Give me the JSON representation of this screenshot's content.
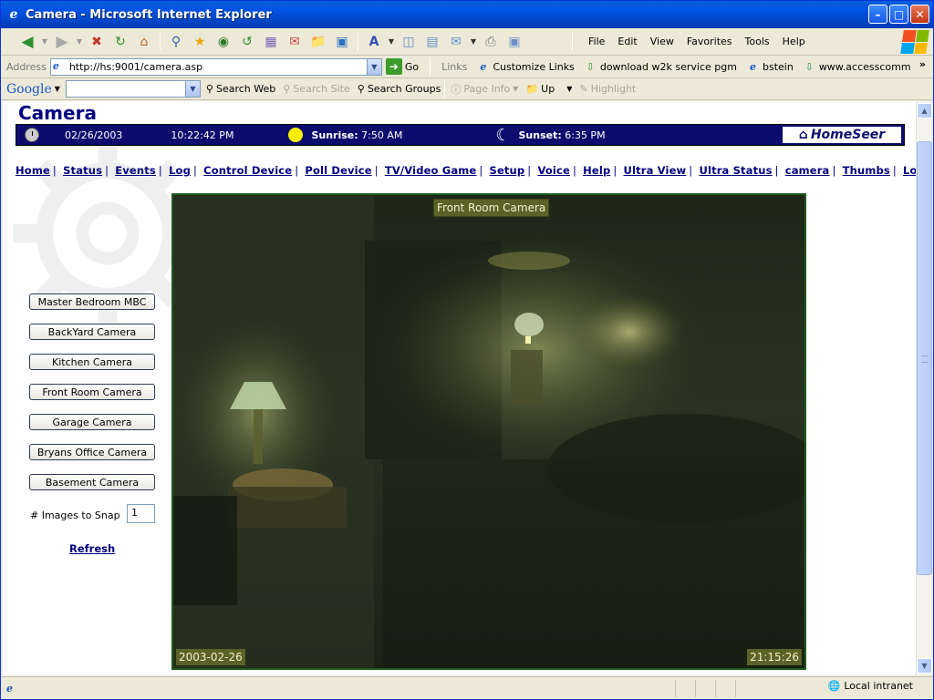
{
  "window": {
    "title": "Camera - Microsoft Internet Explorer"
  },
  "menu": [
    "File",
    "Edit",
    "View",
    "Favorites",
    "Tools",
    "Help"
  ],
  "address": {
    "label": "Address",
    "url": "http://hs:9001/camera.asp",
    "go": "Go"
  },
  "links": {
    "label": "Links",
    "items": [
      "Customize Links",
      "download w2k service pgm",
      "bstein",
      "www.accesscomm"
    ]
  },
  "google_toolbar": {
    "logo": "Google",
    "search_web": "Search Web",
    "search_site": "Search Site",
    "search_groups": "Search Groups",
    "page_info": "Page Info",
    "up": "Up",
    "highlight": "Highlight"
  },
  "page": {
    "title": "Camera",
    "info": {
      "date": "02/26/2003",
      "time": "10:22:42 PM",
      "sunrise_label": "Sunrise:",
      "sunrise": "7:50 AM",
      "sunset_label": "Sunset:",
      "sunset": "6:35 PM",
      "logo": "HomeSeer"
    },
    "nav": [
      "Home",
      "Status",
      "Events",
      "Log",
      "Control Device",
      "Poll Device",
      "TV/Video Game",
      "Setup",
      "Voice",
      "Help",
      "Ultra View",
      "Ultra Status",
      "camera",
      "Thumbs",
      "Log Out"
    ],
    "cameras": [
      "Master Bedroom MBC",
      "BackYard Camera",
      "Kitchen Camera",
      "Front Room Camera",
      "Garage Camera",
      "Bryans Office Camera",
      "Basement Camera"
    ],
    "snap": {
      "label": "# Images to Snap",
      "value": "1"
    },
    "refresh": "Refresh",
    "feed": {
      "label": "Front Room Camera",
      "date": "2003-02-26",
      "time": "21:15:26"
    }
  },
  "status": {
    "zone": "Local intranet"
  }
}
